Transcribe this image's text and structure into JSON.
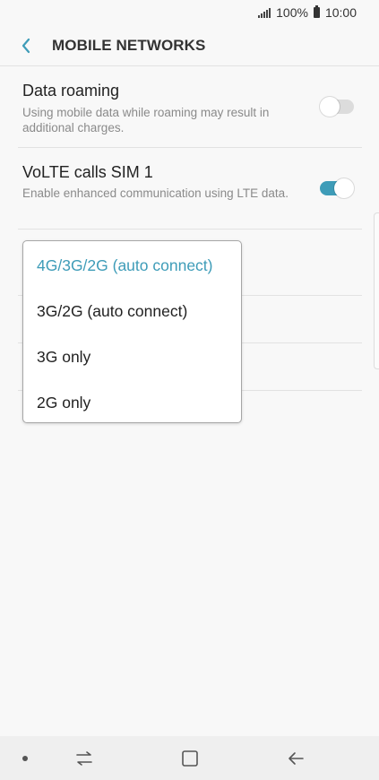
{
  "status": {
    "battery": "100%",
    "time": "10:00"
  },
  "header": {
    "title": "MOBILE NETWORKS"
  },
  "settings": [
    {
      "title": "Data roaming",
      "subtitle": "Using mobile data while roaming may result in additional charges.",
      "enabled": false
    },
    {
      "title": "VoLTE calls SIM 1",
      "subtitle": "Enable enhanced communication using LTE data.",
      "enabled": true
    }
  ],
  "network_mode_menu": {
    "options": [
      "4G/3G/2G (auto connect)",
      "3G/2G (auto connect)",
      "3G only",
      "2G only"
    ],
    "selected": "4G/3G/2G (auto connect)"
  },
  "colors": {
    "accent": "#3e9cb8",
    "toggle_off": "#dcdcdc"
  },
  "navbar": {
    "icons": [
      "dot-icon",
      "recent-apps-icon",
      "home-icon",
      "back-arrow-icon"
    ]
  }
}
